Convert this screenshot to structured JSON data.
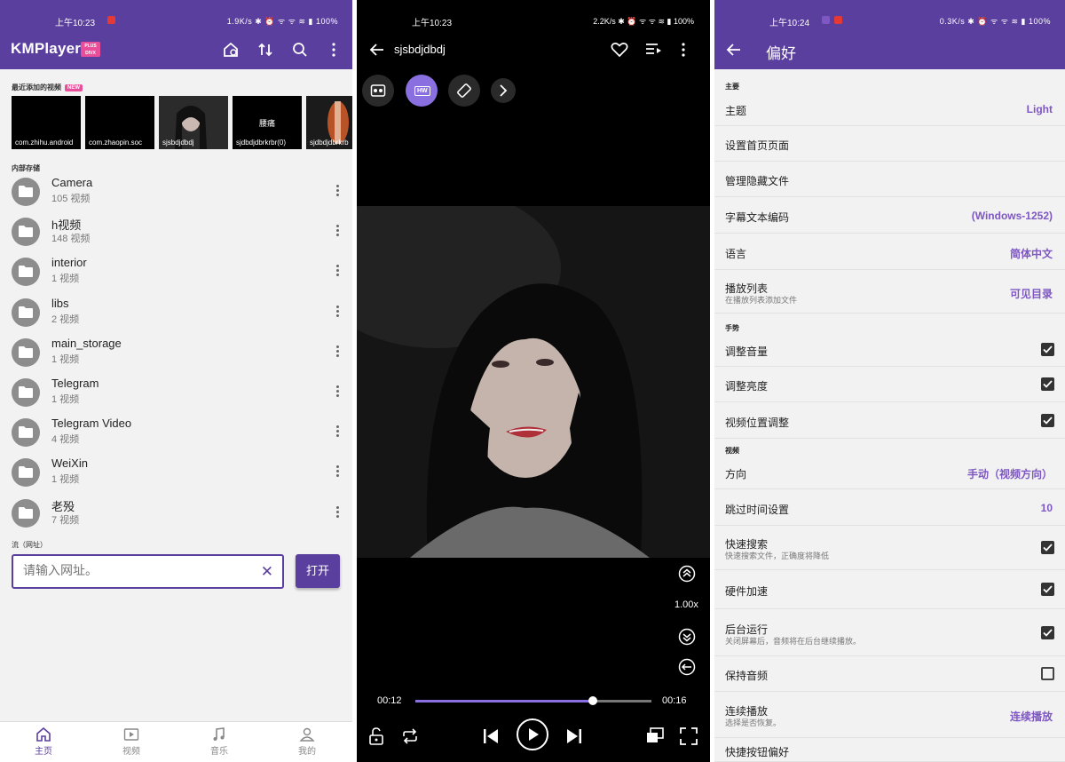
{
  "status": {
    "p1": {
      "time": "上午10:23",
      "right": "1.9K/s ✱ ⏰ ᯤ ᯤ ≋ ▮ 100%"
    },
    "p2": {
      "time": "上午10:23",
      "right": "2.2K/s ✱ ⏰ ᯤ ᯤ ≋ ▮ 100%"
    },
    "p3": {
      "time": "上午10:24",
      "right": "0.3K/s ✱ ⏰ ᯤ ᯤ ≋ ▮ 100%"
    }
  },
  "browser": {
    "logo": "KMPlayer",
    "logo_badge_top": "PLUS",
    "logo_badge_bottom": "DIVX",
    "recent_label": "最近添加的视频",
    "new_badge": "NEW",
    "recent": [
      {
        "label": "com.zhihu.android",
        "mid": ""
      },
      {
        "label": "com.zhaopin.soc",
        "mid": ""
      },
      {
        "label": "sjsbdjdbdj",
        "mid": ""
      },
      {
        "label": "sjdbdjdbrkrbr(0)",
        "mid": "腰痛"
      },
      {
        "label": "sjdbdjdbrkrb",
        "mid": ""
      }
    ],
    "storage_label": "内部存储",
    "folders": [
      {
        "name": "Camera",
        "count": "105 视频"
      },
      {
        "name": "h视频",
        "count": "148 视频"
      },
      {
        "name": "interior",
        "count": "1 视频"
      },
      {
        "name": "libs",
        "count": "2 视频"
      },
      {
        "name": "main_storage",
        "count": "1 视频"
      },
      {
        "name": "Telegram",
        "count": "1 视频"
      },
      {
        "name": "Telegram Video",
        "count": "4 视频"
      },
      {
        "name": "WeiXin",
        "count": "1 视频"
      },
      {
        "name": "老殁",
        "count": "7 视频"
      }
    ],
    "stream_label": "流（网址）",
    "url_placeholder": "请输入网址。",
    "open_label": "打开",
    "nav": [
      {
        "label": "主页",
        "icon": "home-icon",
        "active": true
      },
      {
        "label": "视频",
        "icon": "video-icon",
        "active": false
      },
      {
        "label": "音乐",
        "icon": "music-icon",
        "active": false
      },
      {
        "label": "我的",
        "icon": "person-icon",
        "active": false
      }
    ]
  },
  "player": {
    "title": "sjsbdjdbdj",
    "hw_label": "HW",
    "speed": "1.00x",
    "time_current": "00:12",
    "time_total": "00:16",
    "progress": 0.75
  },
  "prefs": {
    "title": "偏好",
    "sections": [
      {
        "label": "主要",
        "rows": [
          {
            "name": "主题",
            "value": "Light"
          },
          {
            "name": "设置首页页面"
          },
          {
            "name": "管理隐藏文件"
          },
          {
            "name": "字幕文本编码",
            "value": "(Windows-1252)"
          },
          {
            "name": "语言",
            "value": "简体中文"
          },
          {
            "name": "播放列表",
            "sub": "在播放列表添加文件",
            "value": "可见目录"
          }
        ]
      },
      {
        "label": "手势",
        "rows": [
          {
            "name": "调整音量",
            "checked": true
          },
          {
            "name": "调整亮度",
            "checked": true
          },
          {
            "name": "视频位置调整",
            "checked": true
          }
        ]
      },
      {
        "label": "视频",
        "rows": [
          {
            "name": "方向",
            "value": "手动（视频方向）"
          },
          {
            "name": "跳过时间设置",
            "value": "10"
          },
          {
            "name": "快速搜索",
            "sub": "快速搜索文件，正确度将降低",
            "checked": true
          },
          {
            "name": "硬件加速",
            "checked": true
          },
          {
            "name": "后台运行",
            "sub": "关闭屏幕后，音频将在后台继续播放。",
            "checked": true
          },
          {
            "name": "保持音频",
            "checked": false
          },
          {
            "name": "连续播放",
            "sub": "选择是否恢复。",
            "value": "连续播放"
          },
          {
            "name": "快捷按钮偏好"
          }
        ]
      }
    ]
  },
  "colors": {
    "primary": "#5b3f9e",
    "accent": "#7e57c2",
    "badge": "#e94e9a"
  }
}
